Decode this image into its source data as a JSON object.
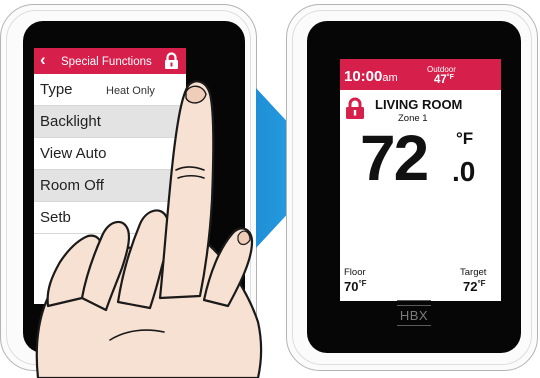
{
  "left_device": {
    "header": {
      "back_icon": "chevron-left-icon",
      "title": "Special Functions",
      "lock_icon": "lock-icon"
    },
    "menu_items": [
      {
        "label": "Type",
        "value": "Heat Only"
      },
      {
        "label": "Backlight",
        "value": ""
      },
      {
        "label": "View Auto",
        "value": ""
      },
      {
        "label": "Room Off",
        "value": ""
      },
      {
        "label": "Setb",
        "value": ""
      }
    ]
  },
  "arrow_icon": "arrow-right-icon",
  "right_device": {
    "time": "10:00",
    "ampm": "am",
    "outdoor_label": "Outdoor",
    "outdoor_value": "47",
    "outdoor_unit": "°F",
    "room_name": "LIVING ROOM",
    "zone": "Zone 1",
    "temperature_whole": "72",
    "temperature_decimal": ".0",
    "temperature_unit": "°F",
    "floor_label": "Floor",
    "floor_value": "70",
    "floor_unit": "°F",
    "target_label": "Target",
    "target_value": "72",
    "target_unit": "°F",
    "brand": "HBX",
    "lock_icon": "lock-icon"
  },
  "colors": {
    "accent_red": "#d71f4b",
    "arrow_blue": "#1e90d8",
    "bezel": "#060606",
    "skin": "#f7e1d2"
  }
}
